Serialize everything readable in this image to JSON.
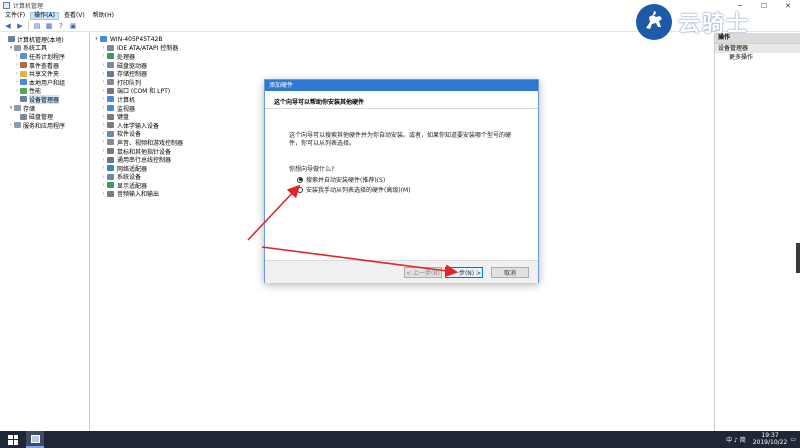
{
  "window": {
    "title": "计算机管理"
  },
  "menu": [
    "文件(F)",
    "操作(A)",
    "查看(V)",
    "帮助(H)"
  ],
  "left_tree": [
    {
      "label": "计算机管理(本地)",
      "level": 0,
      "exp": "",
      "color": "#6b7fa0"
    },
    {
      "label": "系统工具",
      "level": 1,
      "exp": "▾",
      "color": "#8a9bb5"
    },
    {
      "label": "任务计划程序",
      "level": 2,
      "exp": "›",
      "color": "#5a8fd0"
    },
    {
      "label": "事件查看器",
      "level": 2,
      "exp": "›",
      "color": "#b86a3a"
    },
    {
      "label": "共享文件夹",
      "level": 2,
      "exp": "›",
      "color": "#e2b24a"
    },
    {
      "label": "本地用户和组",
      "level": 2,
      "exp": "›",
      "color": "#4a8ad8"
    },
    {
      "label": "性能",
      "level": 2,
      "exp": "›",
      "color": "#5aa35a"
    },
    {
      "label": "设备管理器",
      "level": 2,
      "exp": "",
      "color": "#6b7fa0",
      "selected": true
    },
    {
      "label": "存储",
      "level": 1,
      "exp": "▾",
      "color": "#8a9bb5"
    },
    {
      "label": "磁盘管理",
      "level": 2,
      "exp": "",
      "color": "#7a8aa0"
    },
    {
      "label": "服务和应用程序",
      "level": 1,
      "exp": "›",
      "color": "#8a9bb5"
    }
  ],
  "device_root": "WIN-405P45T42B",
  "devices": [
    {
      "label": "IDE ATA/ATAPI 控制器",
      "color": "#7a8a9a"
    },
    {
      "label": "处理器",
      "color": "#3a9a6a"
    },
    {
      "label": "磁盘驱动器",
      "color": "#7a8a9a"
    },
    {
      "label": "存储控制器",
      "color": "#6a7a8a"
    },
    {
      "label": "打印队列",
      "color": "#8a8a8a"
    },
    {
      "label": "端口 (COM 和 LPT)",
      "color": "#6a7a8a"
    },
    {
      "label": "计算机",
      "color": "#4a8ad8"
    },
    {
      "label": "监视器",
      "color": "#4a8ad8"
    },
    {
      "label": "键盘",
      "color": "#7a7a7a"
    },
    {
      "label": "人体学输入设备",
      "color": "#7a7a8a"
    },
    {
      "label": "软件设备",
      "color": "#6a8aa8"
    },
    {
      "label": "声音、视频和游戏控制器",
      "color": "#8a8a8a"
    },
    {
      "label": "鼠标和其他指针设备",
      "color": "#7a7a7a"
    },
    {
      "label": "通用串行总线控制器",
      "color": "#6a7a8a"
    },
    {
      "label": "网络适配器",
      "color": "#3a8ab8"
    },
    {
      "label": "系统设备",
      "color": "#6a8aa8"
    },
    {
      "label": "显示适配器",
      "color": "#3a9a6a"
    },
    {
      "label": "音频输入和输出",
      "color": "#7a7a8a"
    }
  ],
  "actions": {
    "header": "操作",
    "section": "设备管理器",
    "more": "更多操作"
  },
  "dialog": {
    "title": "添加硬件",
    "header": "这个向导可以帮助你安装其他硬件",
    "description": "这个向导可以搜索其他硬件并为你自动安装。或者，如果你知道要安装哪个型号的硬件，你可以从列表选择。",
    "question": "你想向导做什么?",
    "option1": "搜索并自动安装硬件(推荐)(S)",
    "option2": "安装我手动从列表选择的硬件(高级)(M)",
    "back_button": "< 上一步(B)",
    "next_button": "下一步(N) >",
    "cancel_button": "取消"
  },
  "brand": {
    "text": "云骑士"
  },
  "taskbar": {
    "tray_text": "中 ♪ 简",
    "time": "19:37",
    "date": "2019/10/22"
  },
  "colors": {
    "accent": "#2b79d0",
    "arrow": "#e0242a",
    "taskbar": "#1f2635"
  }
}
